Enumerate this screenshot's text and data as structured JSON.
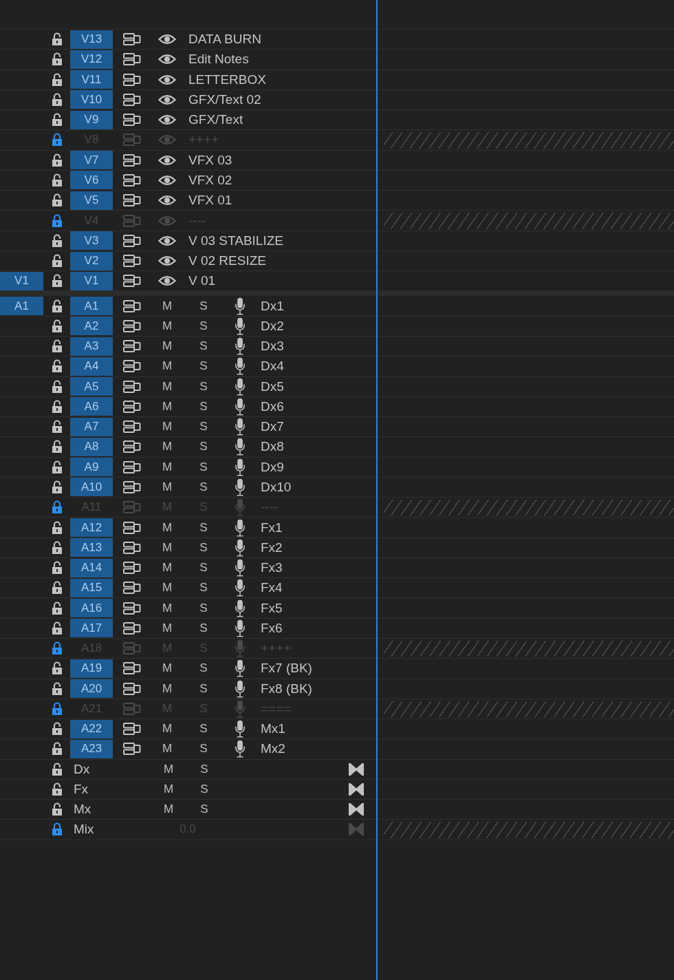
{
  "video_tracks": [
    {
      "label": "V13",
      "targeted": true,
      "locked": false,
      "name": "DATA BURN"
    },
    {
      "label": "V12",
      "targeted": true,
      "locked": false,
      "name": "Edit Notes"
    },
    {
      "label": "V11",
      "targeted": true,
      "locked": false,
      "name": "LETTERBOX"
    },
    {
      "label": "V10",
      "targeted": true,
      "locked": false,
      "name": "GFX/Text 02"
    },
    {
      "label": "V9",
      "targeted": true,
      "locked": false,
      "name": "GFX/Text"
    },
    {
      "label": "V8",
      "targeted": false,
      "locked": true,
      "name": "++++"
    },
    {
      "label": "V7",
      "targeted": true,
      "locked": false,
      "name": "VFX 03"
    },
    {
      "label": "V6",
      "targeted": true,
      "locked": false,
      "name": "VFX 02"
    },
    {
      "label": "V5",
      "targeted": true,
      "locked": false,
      "name": "VFX 01"
    },
    {
      "label": "V4",
      "targeted": false,
      "locked": true,
      "name": "----"
    },
    {
      "label": "V3",
      "targeted": true,
      "locked": false,
      "name": "V 03 STABILIZE"
    },
    {
      "label": "V2",
      "targeted": true,
      "locked": false,
      "name": "V 02 RESIZE"
    },
    {
      "source_patch": "V1",
      "label": "V1",
      "targeted": true,
      "locked": false,
      "name": "V 01"
    }
  ],
  "audio_tracks": [
    {
      "source_patch": "A1",
      "label": "A1",
      "targeted": true,
      "locked": false,
      "mute": "M",
      "solo": "S",
      "name": "Dx1"
    },
    {
      "label": "A2",
      "targeted": true,
      "locked": false,
      "mute": "M",
      "solo": "S",
      "name": "Dx2"
    },
    {
      "label": "A3",
      "targeted": true,
      "locked": false,
      "mute": "M",
      "solo": "S",
      "name": "Dx3"
    },
    {
      "label": "A4",
      "targeted": true,
      "locked": false,
      "mute": "M",
      "solo": "S",
      "name": "Dx4"
    },
    {
      "label": "A5",
      "targeted": true,
      "locked": false,
      "mute": "M",
      "solo": "S",
      "name": "Dx5"
    },
    {
      "label": "A6",
      "targeted": true,
      "locked": false,
      "mute": "M",
      "solo": "S",
      "name": "Dx6"
    },
    {
      "label": "A7",
      "targeted": true,
      "locked": false,
      "mute": "M",
      "solo": "S",
      "name": "Dx7"
    },
    {
      "label": "A8",
      "targeted": true,
      "locked": false,
      "mute": "M",
      "solo": "S",
      "name": "Dx8"
    },
    {
      "label": "A9",
      "targeted": true,
      "locked": false,
      "mute": "M",
      "solo": "S",
      "name": "Dx9"
    },
    {
      "label": "A10",
      "targeted": true,
      "locked": false,
      "mute": "M",
      "solo": "S",
      "name": "Dx10"
    },
    {
      "label": "A11",
      "targeted": false,
      "locked": true,
      "mute": "M",
      "solo": "S",
      "name": "----"
    },
    {
      "label": "A12",
      "targeted": true,
      "locked": false,
      "mute": "M",
      "solo": "S",
      "name": "Fx1"
    },
    {
      "label": "A13",
      "targeted": true,
      "locked": false,
      "mute": "M",
      "solo": "S",
      "name": "Fx2"
    },
    {
      "label": "A14",
      "targeted": true,
      "locked": false,
      "mute": "M",
      "solo": "S",
      "name": "Fx3"
    },
    {
      "label": "A15",
      "targeted": true,
      "locked": false,
      "mute": "M",
      "solo": "S",
      "name": "Fx4"
    },
    {
      "label": "A16",
      "targeted": true,
      "locked": false,
      "mute": "M",
      "solo": "S",
      "name": "Fx5"
    },
    {
      "label": "A17",
      "targeted": true,
      "locked": false,
      "mute": "M",
      "solo": "S",
      "name": "Fx6"
    },
    {
      "label": "A18",
      "targeted": false,
      "locked": true,
      "mute": "M",
      "solo": "S",
      "name": "++++"
    },
    {
      "label": "A19",
      "targeted": true,
      "locked": false,
      "mute": "M",
      "solo": "S",
      "name": "Fx7 (BK)"
    },
    {
      "label": "A20",
      "targeted": true,
      "locked": false,
      "mute": "M",
      "solo": "S",
      "name": "Fx8 (BK)"
    },
    {
      "label": "A21",
      "targeted": false,
      "locked": true,
      "mute": "M",
      "solo": "S",
      "name": "===="
    },
    {
      "label": "A22",
      "targeted": true,
      "locked": false,
      "mute": "M",
      "solo": "S",
      "name": "Mx1"
    },
    {
      "label": "A23",
      "targeted": true,
      "locked": false,
      "mute": "M",
      "solo": "S",
      "name": "Mx2"
    }
  ],
  "mix_tracks": [
    {
      "kind": "submix",
      "locked": false,
      "name": "Dx",
      "mute": "M",
      "solo": "S"
    },
    {
      "kind": "submix",
      "locked": false,
      "name": "Fx",
      "mute": "M",
      "solo": "S"
    },
    {
      "kind": "submix",
      "locked": false,
      "name": "Mx",
      "mute": "M",
      "solo": "S"
    },
    {
      "kind": "master",
      "locked": true,
      "name": "Mix",
      "volume": "0.0"
    }
  ]
}
